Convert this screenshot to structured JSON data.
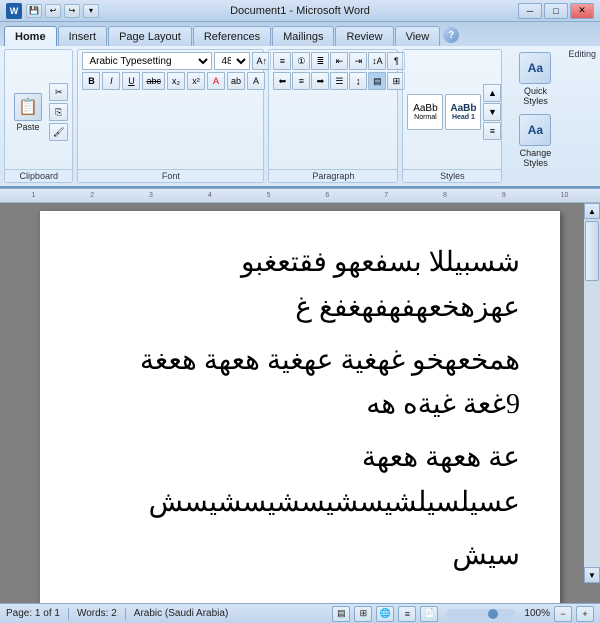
{
  "titleBar": {
    "title": "Document1 - Microsoft Word",
    "icon": "W",
    "minBtn": "─",
    "maxBtn": "□",
    "closeBtn": "✕"
  },
  "tabs": [
    {
      "label": "Home",
      "active": true
    },
    {
      "label": "Insert",
      "active": false
    },
    {
      "label": "Page Layout",
      "active": false
    },
    {
      "label": "References",
      "active": false
    },
    {
      "label": "Mailings",
      "active": false
    },
    {
      "label": "Review",
      "active": false
    },
    {
      "label": "View",
      "active": false
    }
  ],
  "ribbon": {
    "clipboard": {
      "label": "Clipboard",
      "pasteLabel": "Paste"
    },
    "font": {
      "label": "Font",
      "fontName": "Arabic Typesetting",
      "fontSize": "48",
      "boldLabel": "B",
      "italicLabel": "I",
      "underlineLabel": "U",
      "strikeLabel": "abc",
      "subscriptLabel": "x₂",
      "superscriptLabel": "x²",
      "highlightLabel": "ab",
      "colorLabel": "A"
    },
    "paragraph": {
      "label": "Paragraph"
    },
    "styles": {
      "label": "Styles",
      "quickStylesLabel": "Quick\nStyles",
      "changeStylesLabel": "Change\nStyles"
    },
    "editing": {
      "label": "Editing"
    }
  },
  "document": {
    "arabicLines": [
      "شسبيللا بسفعهو فقتعغبو عهزهخعهفهفهغفغ غ",
      "همخعهخو غهغية عهغية هعهة هعغة 9غعة غيةه هه",
      "عة هعهة هعهة عسيلسيلشيسشيسشيسشيسش",
      "سيش"
    ]
  },
  "statusBar": {
    "page": "Page: 1 of 1",
    "words": "Words: 2",
    "language": "Arabic (Saudi Arabia)",
    "zoom": "100%"
  }
}
